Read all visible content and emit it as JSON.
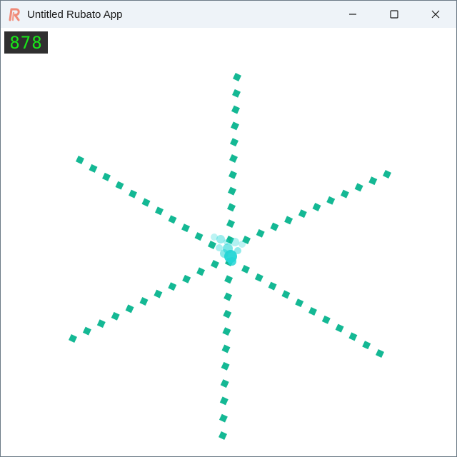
{
  "window": {
    "title": "Untitled Rubato App",
    "icon": "rubato-logo-icon",
    "controls": [
      "minimize-icon",
      "maximize-icon",
      "close-icon"
    ]
  },
  "fps_counter": {
    "value": "878",
    "color": "#19e619",
    "background": "#2f2f2f"
  },
  "scene": {
    "dot_color": "#14b894",
    "cluster_color": "#22d6d6",
    "arms": 6
  }
}
